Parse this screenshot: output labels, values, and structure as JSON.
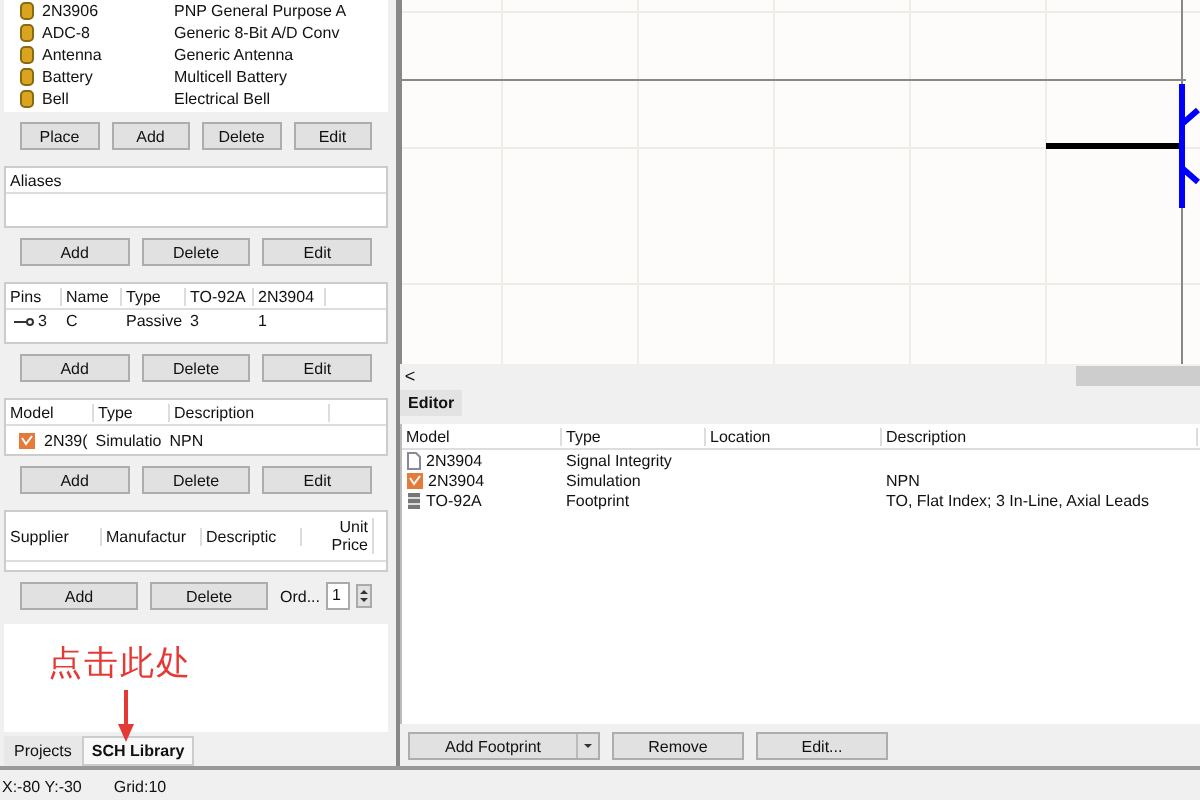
{
  "components": [
    {
      "name": "2N3906",
      "description": "PNP General Purpose A"
    },
    {
      "name": "ADC-8",
      "description": "Generic 8-Bit A/D Conv"
    },
    {
      "name": "Antenna",
      "description": "Generic Antenna"
    },
    {
      "name": "Battery",
      "description": "Multicell Battery"
    },
    {
      "name": "Bell",
      "description": "Electrical Bell"
    }
  ],
  "component_buttons": [
    "Place",
    "Add",
    "Delete",
    "Edit"
  ],
  "aliases": {
    "header": "Aliases",
    "buttons": [
      "Add",
      "Delete",
      "Edit"
    ]
  },
  "pins": {
    "columns": [
      "Pins",
      "Name",
      "Type",
      "TO-92A",
      "2N3904"
    ],
    "rows": [
      [
        "3",
        "C",
        "Passive",
        "3",
        "1"
      ]
    ],
    "buttons": [
      "Add",
      "Delete",
      "Edit"
    ]
  },
  "models": {
    "columns": [
      "Model",
      "Type",
      "Description"
    ],
    "rows": [
      [
        "2N39(",
        "Simulatio",
        "NPN"
      ]
    ],
    "buttons": [
      "Add",
      "Delete",
      "Edit"
    ]
  },
  "suppliers": {
    "columns": [
      "Supplier",
      "Manufactur",
      "Descriptic",
      "Unit Price"
    ],
    "buttons": [
      "Add",
      "Delete"
    ],
    "order_label": "Ord...",
    "order_value": "1"
  },
  "annotation": {
    "text": "点击此处"
  },
  "tabs": [
    {
      "label": "Projects",
      "selected": false
    },
    {
      "label": "SCH Library",
      "selected": true
    }
  ],
  "scroll_left": "<",
  "editor": {
    "tab": "Editor",
    "columns": [
      "Model",
      "Type",
      "Location",
      "Description"
    ],
    "rows": [
      {
        "kind": "doc",
        "model": "2N3904",
        "type": "Signal Integrity",
        "location": "",
        "description": ""
      },
      {
        "kind": "sim",
        "model": "2N3904",
        "type": "Simulation",
        "location": "",
        "description": "NPN"
      },
      {
        "kind": "footprint",
        "model": "TO-92A",
        "type": "Footprint",
        "location": "",
        "description": "TO, Flat Index; 3 In-Line, Axial Leads"
      }
    ],
    "buttons": [
      "Add Footprint",
      "Remove",
      "Edit..."
    ]
  },
  "status_bar": {
    "position": "X:-80 Y:-30",
    "grid": "Grid:10"
  }
}
